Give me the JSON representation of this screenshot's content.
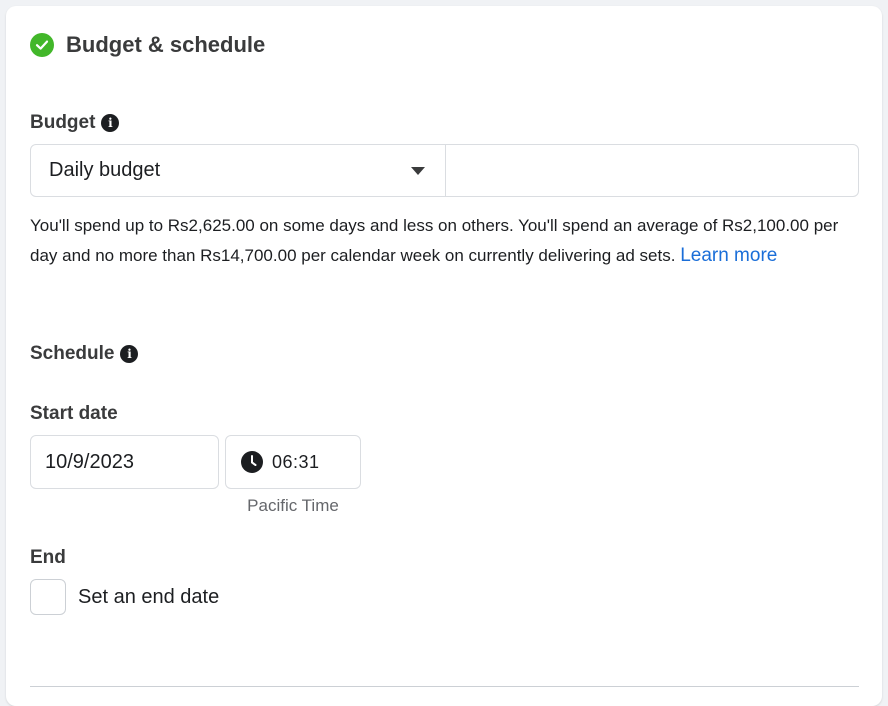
{
  "section": {
    "title": "Budget & schedule",
    "status_icon": "check-circle-icon",
    "status_color": "#42b72a"
  },
  "budget": {
    "label": "Budget",
    "type_selected": "Daily budget",
    "amount_value": "",
    "description": "You'll spend up to Rs2,625.00 on some days and less on others. You'll spend an average of Rs2,100.00 per day and no more than Rs14,700.00 per calendar week on currently delivering ad sets.",
    "learn_more": "Learn more"
  },
  "schedule": {
    "label": "Schedule",
    "start_date_label": "Start date",
    "start_date": "10/9/2023",
    "start_time": "06:31",
    "timezone": "Pacific Time",
    "end_label": "End",
    "end_checkbox_label": "Set an end date",
    "end_checked": false
  },
  "colors": {
    "link": "#1a6ed8",
    "text": "#1c1e21",
    "muted": "#65676b"
  }
}
